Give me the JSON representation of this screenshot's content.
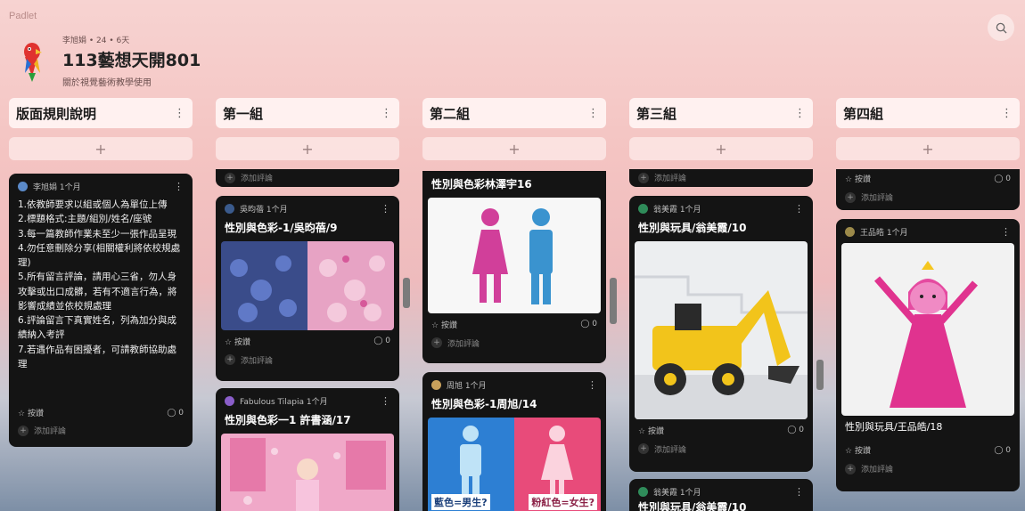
{
  "app": {
    "brand": "Padlet"
  },
  "board": {
    "meta": "李旭娟 • 24 • 6天",
    "title": "113藝想天開801",
    "subtitle": "關於視覺藝術教學使用"
  },
  "columns": [
    {
      "title": "版面規則說明"
    },
    {
      "title": "第一組"
    },
    {
      "title": "第二組"
    },
    {
      "title": "第三組"
    },
    {
      "title": "第四組"
    }
  ],
  "rules_card": {
    "author": "李旭娟 1个月",
    "lines": [
      "1.依教師要求以組或個人為單位上傳",
      "2.標題格式:主題/組別/姓名/座號",
      "3.每一篇教師作業未至少一張作品呈現",
      "4.勿任意刪除分享(相關權利將依校規處理)",
      "5.所有留言評論，請用心三省，勿人身攻擊或出口成髒，若有不適言行為，將影響成績並依校規處理",
      "6.評論留言下真實姓名，列為加分與成績納入考評",
      "7.若遇作品有困擾者，可請教師協助處理"
    ],
    "like": "按讚",
    "count": "0",
    "add_comment": "添加評論"
  },
  "group1": {
    "top_comment": "添加評論",
    "card1": {
      "author": "吳昀蓓 1个月",
      "title": "性別與色彩-1/吳昀蓓/9",
      "like": "按讚",
      "count": "0",
      "add_comment": "添加評論"
    },
    "card2": {
      "author": "Fabulous Tilapia 1个月",
      "title": "性別與色彩一1 許書涵/17"
    }
  },
  "group2": {
    "card1": {
      "title": "性別與色彩林澤宇16",
      "like": "按讚",
      "count": "0",
      "add_comment": "添加評論"
    },
    "card2": {
      "author": "周旭 1个月",
      "title": "性別與色彩-1周旭/14",
      "caption_left": "藍色=男生?",
      "caption_right": "粉紅色=女生?"
    }
  },
  "group3": {
    "top_comment": "添加評論",
    "card1": {
      "author": "翁美霞 1个月",
      "title": "性別與玩具/翁美霞/10",
      "like": "按讚",
      "count": "0",
      "add_comment": "添加評論"
    },
    "card2": {
      "author": "翁美霞 1个月",
      "title": "性別與玩具/翁美霞/10"
    }
  },
  "group4": {
    "top_like": "按讚",
    "top_count": "0",
    "top_comment": "添加評論",
    "card1": {
      "author": "王品皓 1个月",
      "caption": "性別與玩具/王品皓/18",
      "like": "按讚",
      "count": "0",
      "add_comment": "添加評論"
    }
  }
}
